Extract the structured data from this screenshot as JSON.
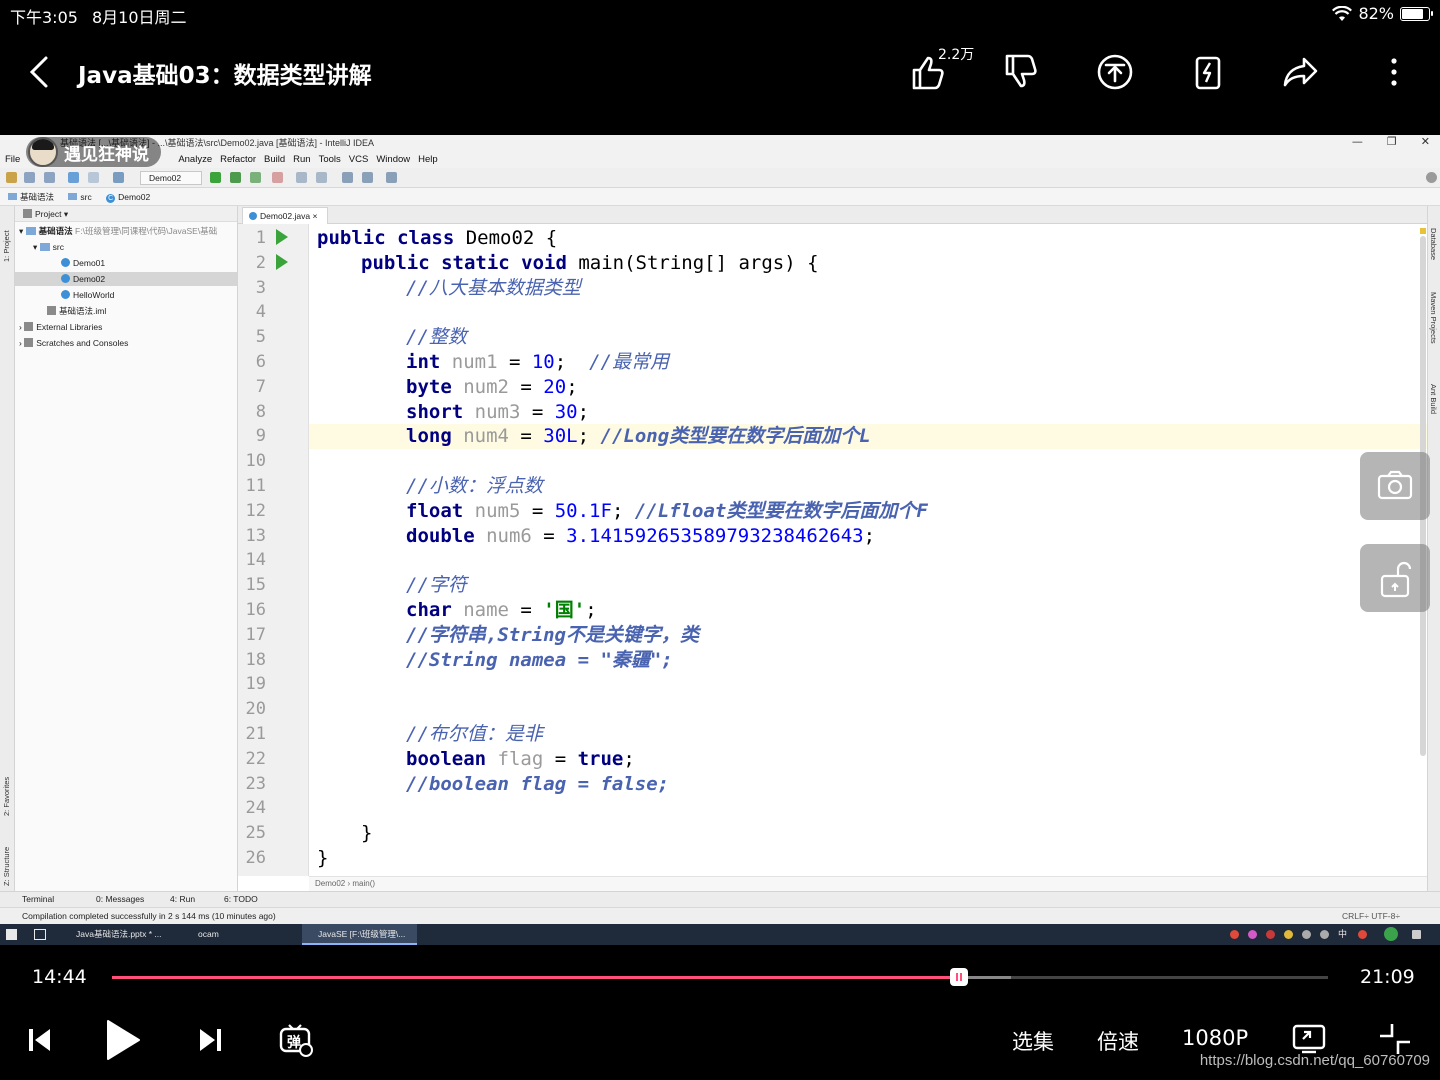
{
  "status_bar": {
    "time": "下午3:05",
    "date": "8月10日周二",
    "battery_text": "82%",
    "battery_level": 0.82
  },
  "header": {
    "title": "Java基础03：数据类型讲解",
    "like_count": "2.2万"
  },
  "ide": {
    "window_title": "基础语法 [...\\基础语法] - ...\\基础语法\\src\\Demo02.java [基础语法] - IntelliJ IDEA",
    "menu": [
      "File",
      "Analyze",
      "Refactor",
      "Build",
      "Run",
      "Tools",
      "VCS",
      "Window",
      "Help"
    ],
    "run_config": "Demo02",
    "nav": [
      "基础语法",
      "src",
      "Demo02"
    ],
    "project_header": "Project",
    "tree": {
      "root": "基础语法",
      "root_path": "F:\\班级管理\\同课程\\代码\\JavaSE\\基础",
      "src": "src",
      "files": [
        "Demo01",
        "Demo02",
        "HelloWorld"
      ],
      "iml": "基础语法.iml",
      "ext_libs": "External Libraries",
      "scratches": "Scratches and Consoles"
    },
    "left_strip": [
      "1: Project",
      "2: Favorites",
      "Z: Structure"
    ],
    "right_strip": [
      "Database",
      "Maven Projects",
      "Ant Build"
    ],
    "editor_tab": "Demo02.java",
    "line_numbers": [
      "1",
      "2",
      "3",
      "4",
      "5",
      "6",
      "7",
      "8",
      "9",
      "10",
      "11",
      "12",
      "13",
      "14",
      "15",
      "16",
      "17",
      "18",
      "19",
      "20",
      "21",
      "22",
      "23",
      "24",
      "25",
      "26"
    ],
    "code": {
      "l1": [
        "public class ",
        "Demo02 {"
      ],
      "l2": [
        "public static void ",
        "main(String[] args) {"
      ],
      "l3": "//八大基本数据类型",
      "l5": "//整数",
      "l6": [
        "int",
        " num1",
        " = ",
        "10",
        ";  ",
        "//最常用"
      ],
      "l7": [
        "byte",
        " num2",
        " = ",
        "20",
        ";"
      ],
      "l8": [
        "short",
        " num3",
        " = ",
        "30",
        ";"
      ],
      "l9": [
        "long",
        " num4",
        " = ",
        "30L",
        "; ",
        "//Long类型要在数字后面加个L"
      ],
      "l11": "//小数：浮点数",
      "l12": [
        "float",
        " num5",
        " = ",
        "50.1F",
        "; ",
        "//Lfloat类型要在数字后面加个F"
      ],
      "l13": [
        "double",
        " num6",
        " = ",
        "3.141592653589793238462643",
        ";"
      ],
      "l15": "//字符",
      "l16": [
        "char",
        " name",
        " = ",
        "'国'",
        ";"
      ],
      "l17": "//字符串,String不是关键字，类",
      "l18": "//String namea = \"秦疆\";",
      "l21": "//布尔值：是非",
      "l22": [
        "boolean",
        " flag",
        " = ",
        "true",
        ";"
      ],
      "l23": "//boolean flag = false;",
      "l25": "}",
      "l26": "}"
    },
    "breadcrumb": "Demo02  ›  main()",
    "bottom_tabs": [
      "Terminal",
      "0: Messages",
      "4: Run",
      "6: TODO"
    ],
    "status_msg": "Compilation completed successfully in 2 s 144 ms (10 minutes ago)",
    "status_right": "CRLF÷  UTF-8÷",
    "taskbar": [
      "Java基础语法.pptx * ...",
      "ocam",
      "JavaSE [F:\\班级管理\\..."
    ],
    "tray_ch": "中"
  },
  "watermark": "遇见狂神说",
  "player": {
    "current_time": "14:44",
    "total_time": "21:09",
    "progress": 0.6965,
    "buffered": 0.739,
    "episodes_label": "选集",
    "speed_label": "倍速",
    "quality_label": "1080P"
  },
  "credit": "https://blog.csdn.net/qq_60760709",
  "colors": {
    "accent": "#ff4f7a",
    "keyword": "#000080",
    "comment": "#4a63b0",
    "number": "#0000ff",
    "string": "#008000"
  }
}
